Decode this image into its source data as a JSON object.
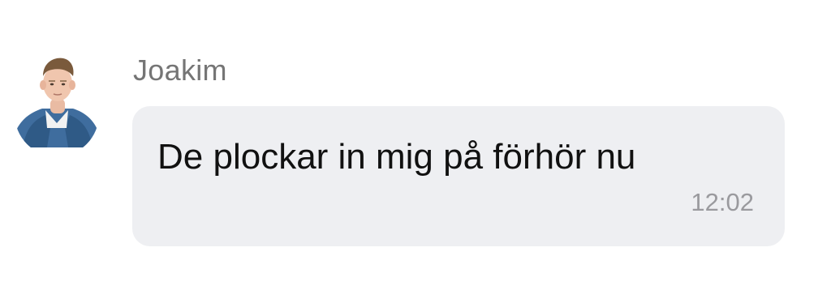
{
  "conversation": {
    "message": {
      "sender_name": "Joakim",
      "avatar_icon": "user-avatar-photo",
      "text": "De plockar in mig på förhör nu",
      "time": "12:02",
      "bubble_color": "#eeeff2"
    }
  }
}
